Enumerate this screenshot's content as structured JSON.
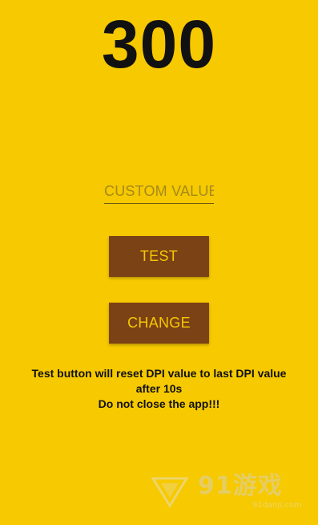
{
  "dpi": {
    "current_value": "300"
  },
  "custom_input": {
    "placeholder": "CUSTOM VALUE",
    "value": ""
  },
  "buttons": {
    "test_label": "TEST",
    "change_label": "CHANGE"
  },
  "note": {
    "line1": "Test button will reset DPI value to last DPI value",
    "line2": "after 10s",
    "line3": "Do not close the app!!!"
  },
  "watermark": {
    "brand": "91游戏",
    "url": "91danji.com"
  },
  "colors": {
    "background": "#f6c900",
    "button": "#7b4216",
    "button_text": "#f6c900",
    "text": "#111111"
  }
}
